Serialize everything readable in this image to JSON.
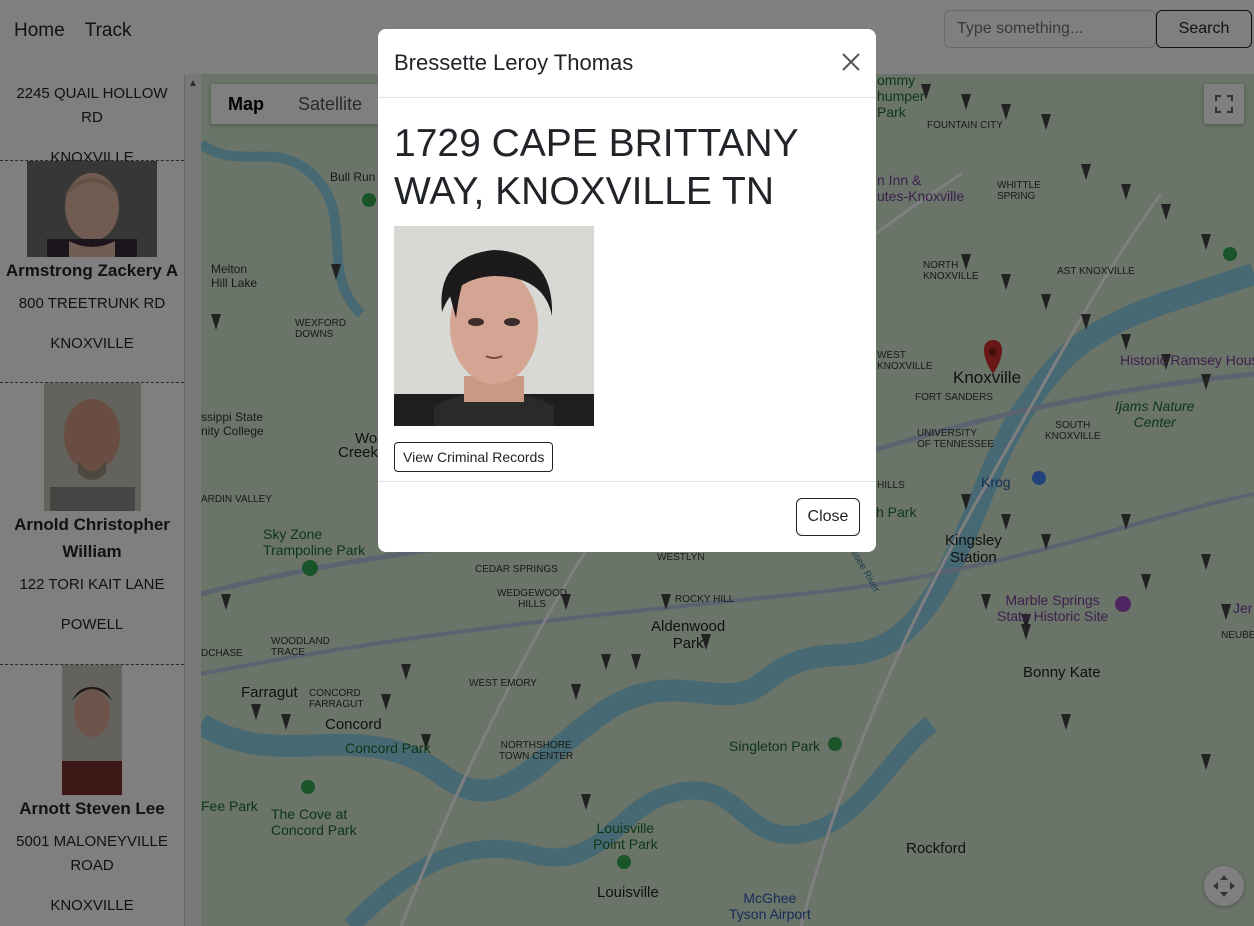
{
  "nav": {
    "home_label": "Home",
    "track_label": "Track",
    "search_placeholder": "Type something...",
    "search_button": "Search"
  },
  "sidebar": {
    "first_address": "2245 QUAIL HOLLOW RD",
    "first_city": "KNOXVILLE",
    "people": [
      {
        "name": "Armstrong Zackery A",
        "address": "800 TREETRUNK RD",
        "city": "KNOXVILLE"
      },
      {
        "name": "Arnold Christopher William",
        "address": "122 TORI KAIT LANE",
        "city": "POWELL"
      },
      {
        "name": "Arnott Steven Lee",
        "address": "5001 MALONEYVILLE ROAD",
        "city": "KNOXVILLE"
      }
    ]
  },
  "map": {
    "type_map": "Map",
    "type_satellite": "Satellite",
    "labels": {
      "bull_run": "Bull Run",
      "melton_hill_lake": "Melton\nHill Lake",
      "wexford_downs": "WEXFORD\nDOWNS",
      "state_college": "ssippi State\nnity College",
      "woo": "Woo",
      "creek": "Creek",
      "ardin_valley": "ARDIN VALLEY",
      "sky_zone": "Sky Zone\nTrampoline Park",
      "woodland_trace": "WOODLAND\nTRACE",
      "dchase": "DCHASE",
      "farragut": "Farragut",
      "concord_farragut": "CONCORD\nFARRAGUT",
      "concord": "Concord",
      "concord_park": "Concord Park",
      "fee_park": "Fee Park",
      "cove_concord": "The Cove at\nConcord Park",
      "cedar_springs": "CEDAR SPRINGS",
      "wedgewood_hills": "WEDGEWOOD\nHILLS",
      "westlyn": "WESTLYN",
      "rocky_hill": "ROCKY HILL",
      "aldenwood_park": "Aldenwood\nPark",
      "west_emory": "WEST EMORY",
      "northshore": "NORTHSHORE\nTOWN CENTER",
      "singleton_park": "Singleton Park",
      "louisville_point": "Louisville\nPoint Park",
      "louisville": "Louisville",
      "mcghee_tyson": "McGhee\nTyson Airport",
      "rockford": "Rockford",
      "bonny_kate": "Bonny Kate",
      "marble_springs": "Marble Springs\nState Historic Site",
      "kingsley_station": "Kingsley\nStation",
      "knoxville": "Knoxville",
      "fort_sanders": "FORT SANDERS",
      "university_tn": "UNIVERSITY\nOF TENNESSEE",
      "west_knoxville": "WEST\nKNOXVILLE",
      "north_knoxville": "NORTH\nKNOXVILLE",
      "east_knoxville": "AST KNOXVILLE",
      "whittle_springs": "WHITTLE\nSPRING",
      "fountain_city": "FOUNTAIN CITY",
      "south_knoxville": "SOUTH\nKNOXVILLE",
      "ijams": "Ijams Nature\nCenter",
      "historic_ramsey": "Historic Ramsey Hous",
      "jer": "Jer",
      "neubert": "NEUBERT",
      "kroger": "Krog",
      "hills": "HILLS",
      "h_park": "h Park",
      "tommy": "ommy\nhumper\nPark",
      "hampton": "n Inn &\nutes-Knoxville",
      "tennessee_river": "Tennessee River"
    }
  },
  "modal": {
    "title": "Bressette Leroy Thomas",
    "address": "1729 CAPE BRITTANY WAY, KNOXVILLE TN",
    "records_button": "View Criminal Records",
    "close_button": "Close"
  },
  "colors": {
    "backdrop": "#000000",
    "map_land": "#cfe6cf",
    "map_water": "#8fd3e6",
    "pin": "#d32f2f"
  }
}
